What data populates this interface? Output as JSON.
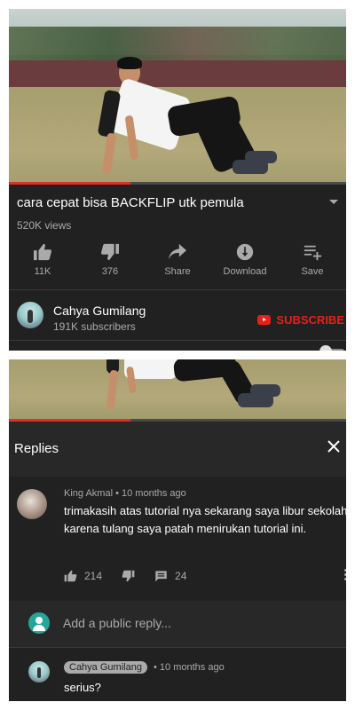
{
  "video": {
    "title": "cara cepat bisa BACKFLIP utk pemula",
    "views": "520K views",
    "progress": 0.36
  },
  "actions": [
    {
      "icon": "thumbs-up-icon",
      "label": "11K"
    },
    {
      "icon": "thumbs-down-icon",
      "label": "376"
    },
    {
      "icon": "share-icon",
      "label": "Share"
    },
    {
      "icon": "download-icon",
      "label": "Download"
    },
    {
      "icon": "save-playlist-icon",
      "label": "Save"
    }
  ],
  "channel": {
    "name": "Cahya Gumilang",
    "subscribers": "191K subscribers",
    "subscribe_label": "SUBSCRIBE"
  },
  "replies_panel": {
    "title": "Replies"
  },
  "comment": {
    "author": "King Akmal",
    "time": "10 months ago",
    "text": "trimakasih atas tutorial nya sekarang saya libur sekolah karena tulang saya patah menirukan tutorial ini.",
    "likes": "214",
    "replies": "24"
  },
  "reply_input": {
    "placeholder": "Add a public reply..."
  },
  "reply": {
    "author": "Cahya Gumilang",
    "time": "10 months ago",
    "text": "serius?"
  },
  "colors": {
    "background": "#212121",
    "panel": "#282828",
    "subscribe": "#e62117",
    "progress": "#e52d27",
    "secondary_text": "#aaaaaa"
  }
}
